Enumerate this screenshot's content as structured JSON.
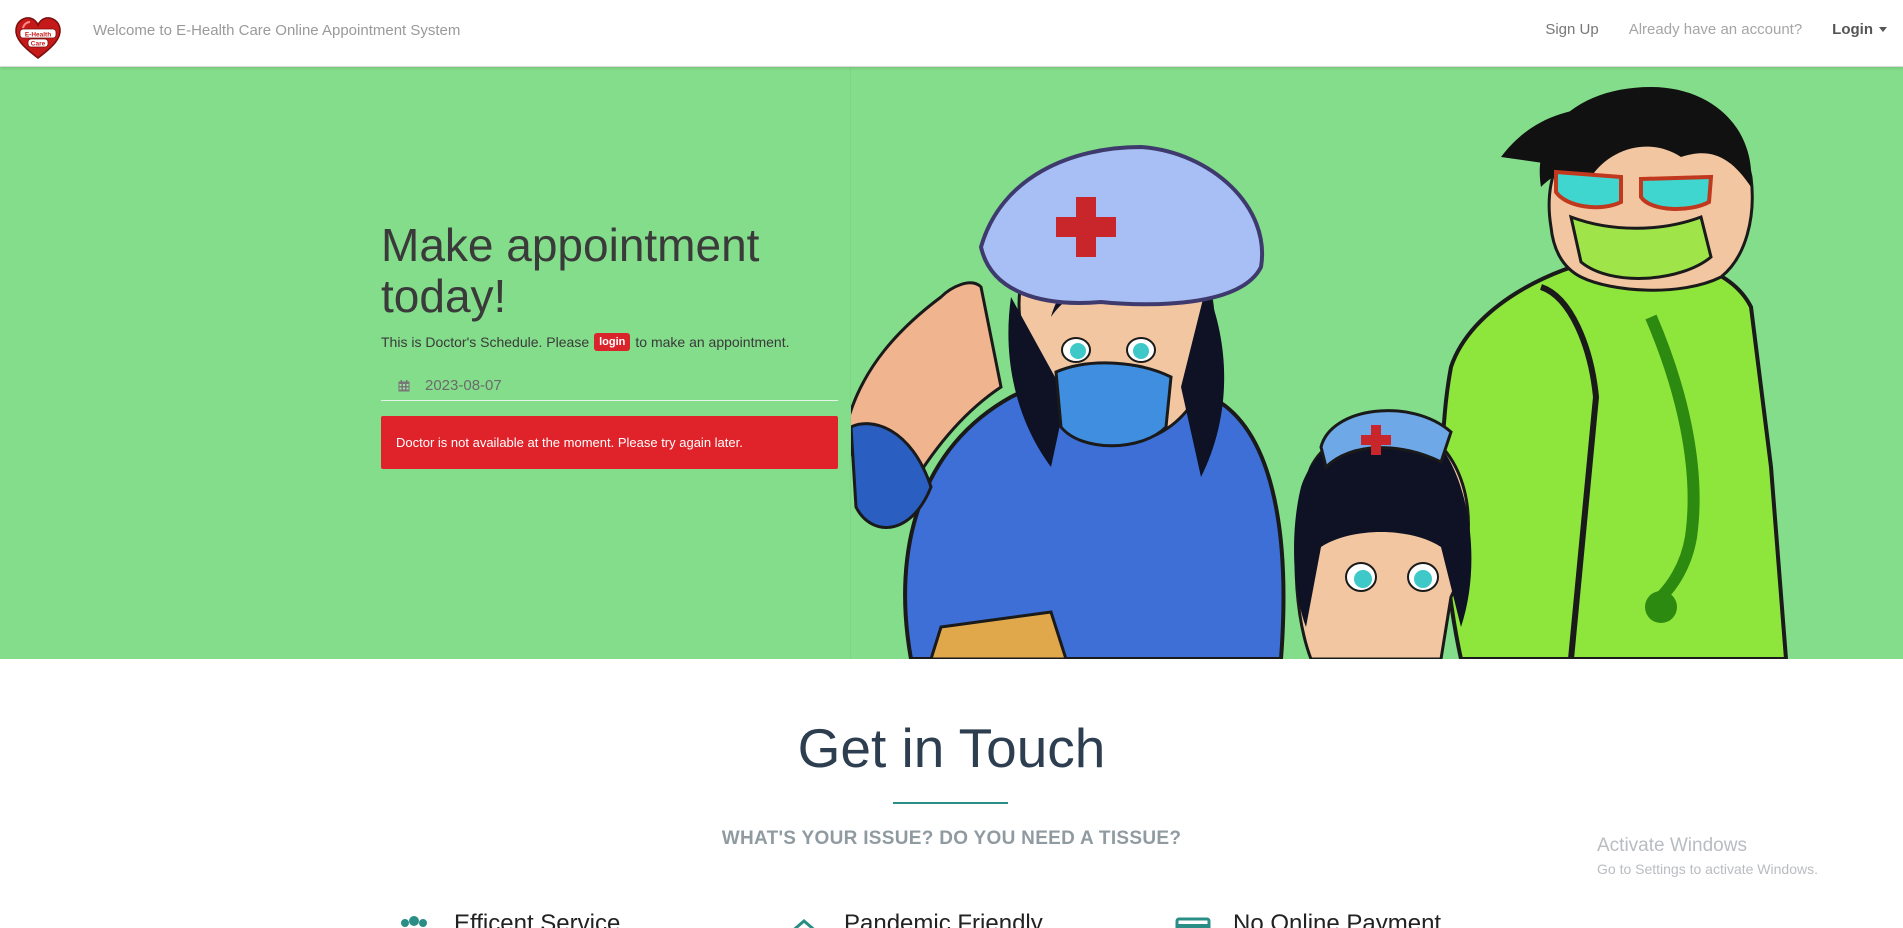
{
  "navbar": {
    "logo_text": "E-Health Care",
    "welcome": "Welcome to E-Health Care Online Appointment System",
    "signup": "Sign Up",
    "already": "Already have an account?",
    "login": "Login"
  },
  "hero": {
    "title": "Make appointment today!",
    "text_before": "This is Doctor's Schedule. Please",
    "login_badge": "login",
    "text_after": "to make an appointment.",
    "date_value": "2023-08-07",
    "alert": "Doctor is not available at the moment. Please try again later."
  },
  "contact": {
    "title": "Get in Touch",
    "subtitle": "WHAT'S YOUR ISSUE? DO YOU NEED A TISSUE?",
    "features": [
      {
        "title": "Efficent Service",
        "icon": "users-icon"
      },
      {
        "title": "Pandemic Friendly",
        "icon": "house-icon"
      },
      {
        "title": "No Online Payment",
        "icon": "credit-card-icon"
      }
    ]
  },
  "watermark": {
    "line1": "Activate Windows",
    "line2": "Go to Settings to activate Windows."
  },
  "colors": {
    "hero_bg": "#83dd8a",
    "alert_red": "#e0222a",
    "accent_teal": "#2a8e86",
    "heading_dark": "#2d3e50"
  }
}
